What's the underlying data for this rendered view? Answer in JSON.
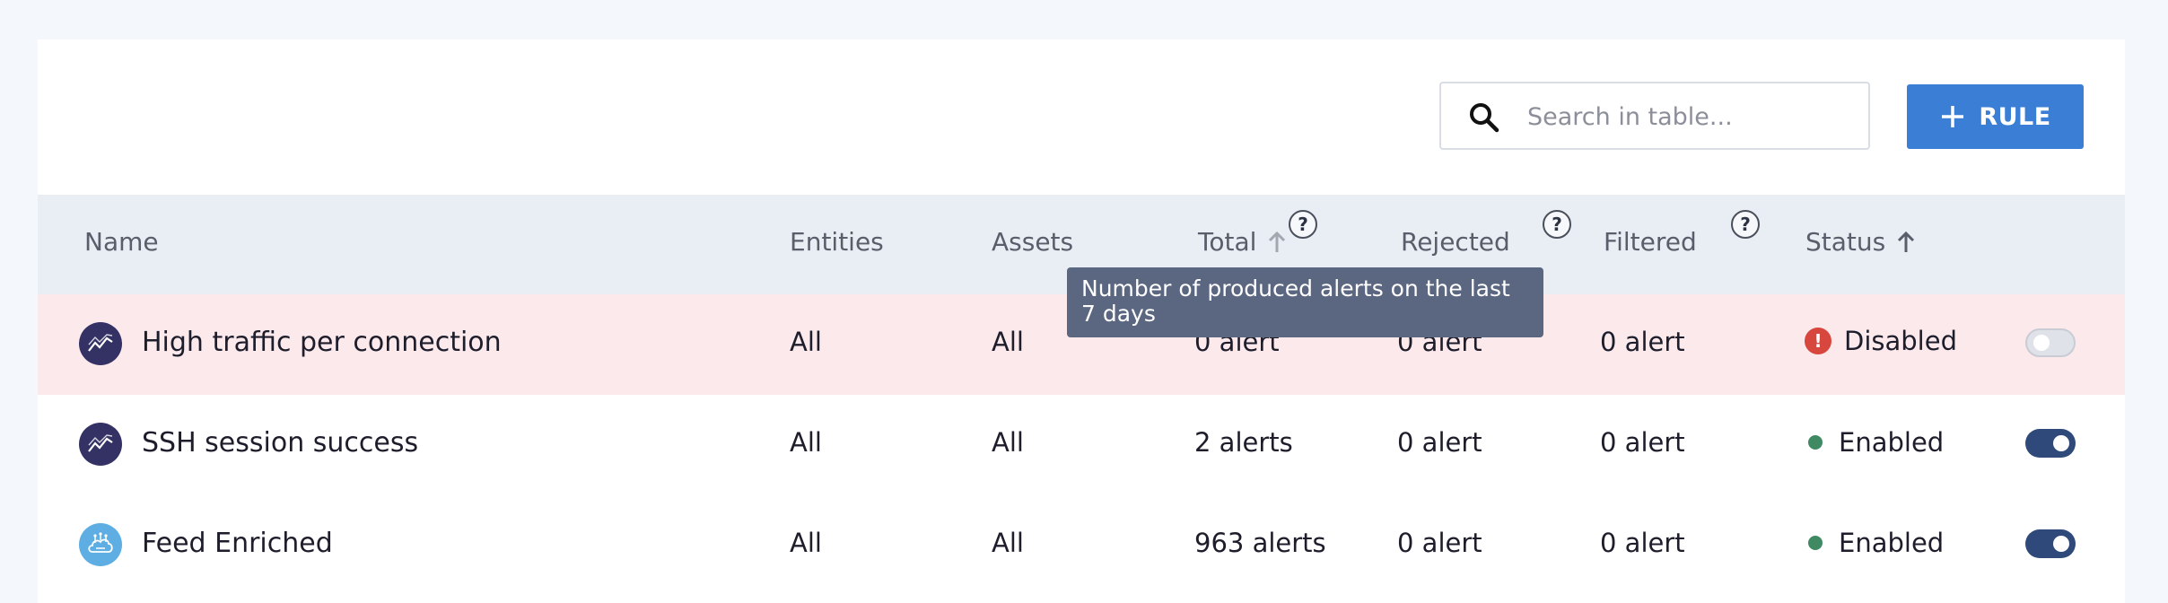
{
  "search": {
    "placeholder": "Search in table..."
  },
  "toolbar": {
    "add_rule_label": "RULE"
  },
  "table": {
    "columns": {
      "name": "Name",
      "entities": "Entities",
      "assets": "Assets",
      "total": "Total",
      "rejected": "Rejected",
      "filtered": "Filtered",
      "status": "Status"
    },
    "help_glyph": "?",
    "rows": [
      {
        "name": "High traffic per connection",
        "entities": "All",
        "assets": "All",
        "total": "0 alert",
        "rejected": "0 alert",
        "filtered": "0 alert",
        "status": "Disabled",
        "enabled": false
      },
      {
        "name": "SSH session success",
        "entities": "All",
        "assets": "All",
        "total": "2 alerts",
        "rejected": "0 alert",
        "filtered": "0 alert",
        "status": "Enabled",
        "enabled": true
      },
      {
        "name": "Feed Enriched",
        "entities": "All",
        "assets": "All",
        "total": "963 alerts",
        "rejected": "0 alert",
        "filtered": "0 alert",
        "status": "Enabled",
        "enabled": true
      }
    ]
  },
  "tooltip": {
    "text": "Number of produced alerts on the last 7 days"
  },
  "status_error_glyph": "!",
  "colors": {
    "accent": "#3a7fd5",
    "header_bg": "#e9eef5",
    "alert_row_bg": "#fbe9ec",
    "enabled_dot": "#3f8a62",
    "error_badge": "#d8473d",
    "toggle_on": "#2f4a7a",
    "tooltip_bg": "#5b6680"
  }
}
